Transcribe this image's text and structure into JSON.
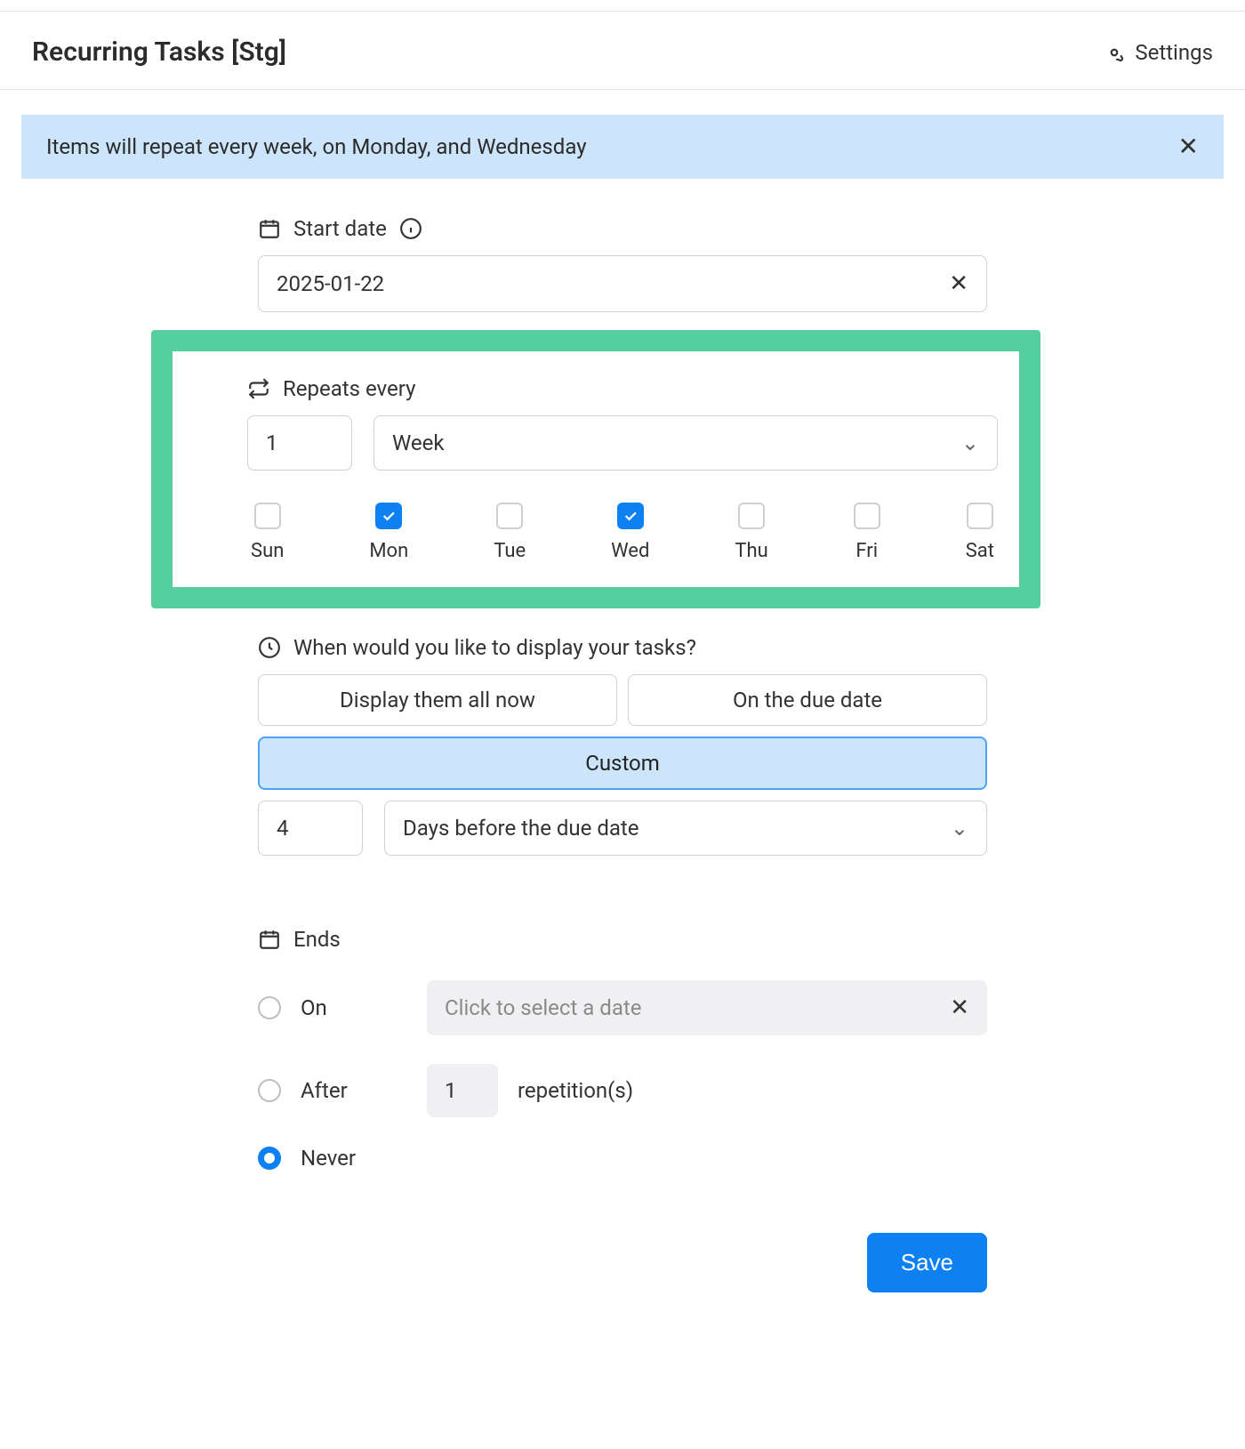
{
  "header": {
    "title": "Recurring Tasks [Stg]",
    "settings_label": "Settings"
  },
  "banner": {
    "text": "Items will repeat every week, on Monday, and Wednesday"
  },
  "start_date": {
    "label": "Start date",
    "value": "2025-01-22"
  },
  "repeats": {
    "label": "Repeats every",
    "interval": "1",
    "unit": "Week",
    "days": [
      {
        "abbr": "Sun",
        "checked": false
      },
      {
        "abbr": "Mon",
        "checked": true
      },
      {
        "abbr": "Tue",
        "checked": false
      },
      {
        "abbr": "Wed",
        "checked": true
      },
      {
        "abbr": "Thu",
        "checked": false
      },
      {
        "abbr": "Fri",
        "checked": false
      },
      {
        "abbr": "Sat",
        "checked": false
      }
    ]
  },
  "display": {
    "label": "When would you like to display your tasks?",
    "options": {
      "all_now": "Display them all now",
      "due_date": "On the due date",
      "custom": "Custom"
    },
    "selected": "custom",
    "custom_value": "4",
    "custom_unit": "Days before the due date"
  },
  "ends": {
    "label": "Ends",
    "on_label": "On",
    "on_placeholder": "Click to select a date",
    "after_label": "After",
    "after_value": "1",
    "after_suffix": "repetition(s)",
    "never_label": "Never",
    "selected": "never"
  },
  "footer": {
    "save_label": "Save"
  }
}
